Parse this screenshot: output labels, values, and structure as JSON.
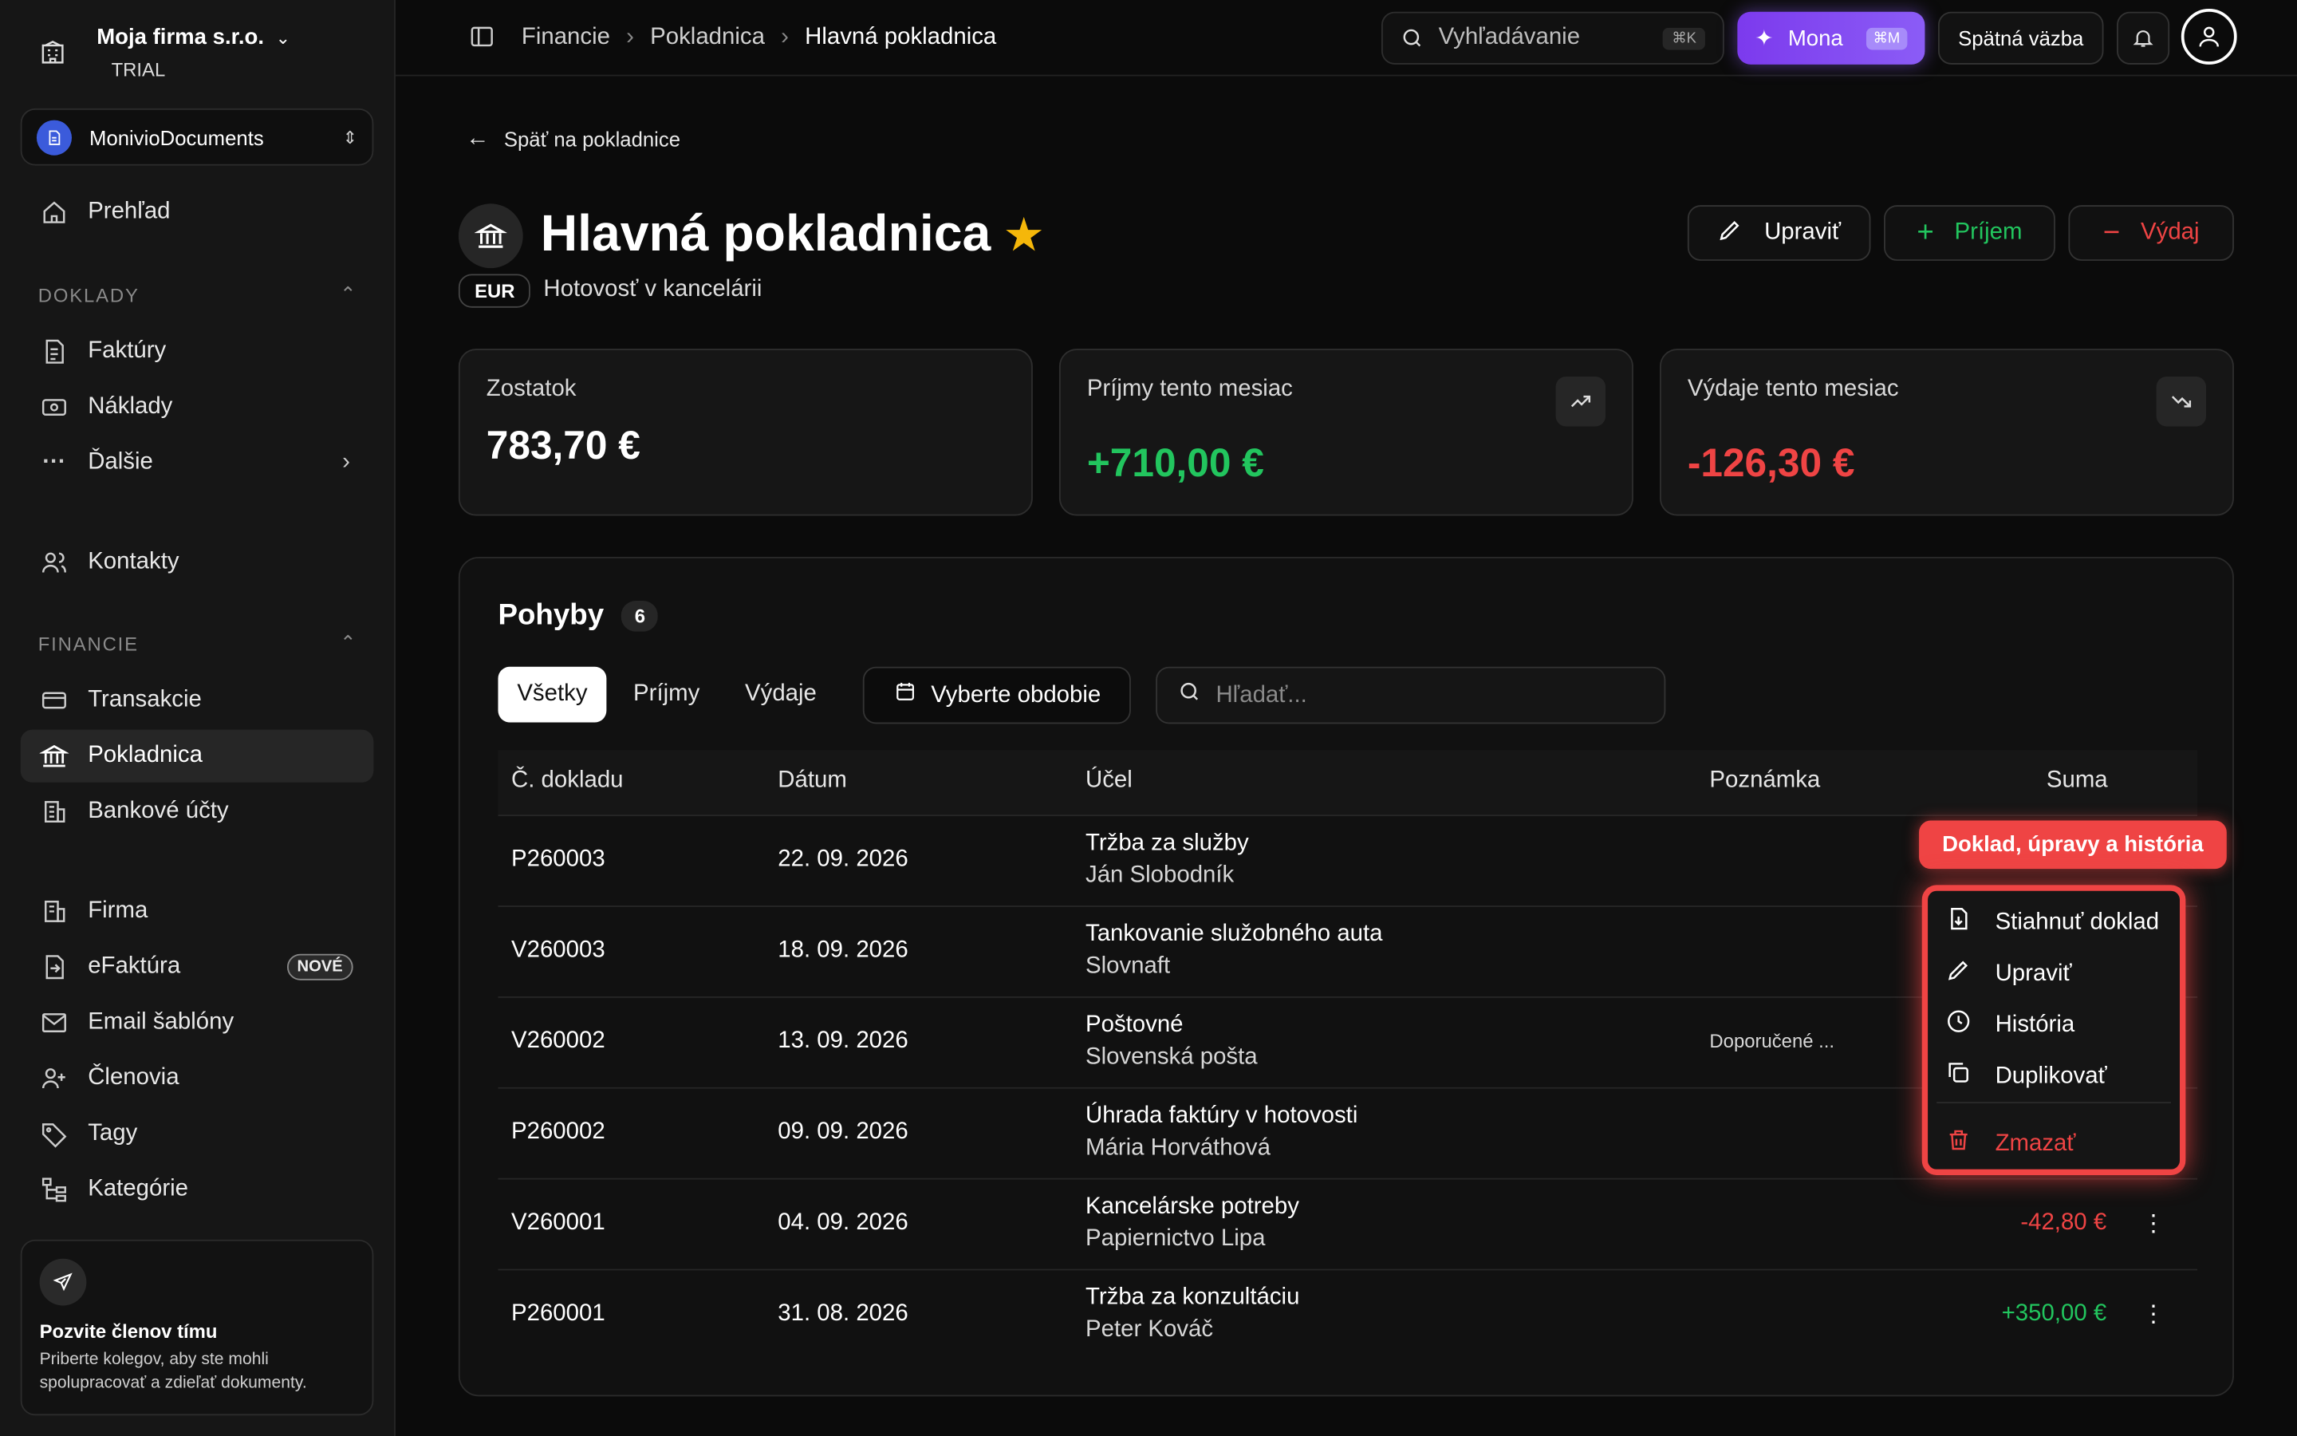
{
  "workspace": {
    "name": "Moja firma s.r.o.",
    "plan": "TRIAL"
  },
  "app_switcher": {
    "name": "MonivioDocuments"
  },
  "sidebar": {
    "overview": "Prehľad",
    "sections": {
      "documents": "DOKLADY",
      "finance": "FINANCIE"
    },
    "documents_items": [
      "Faktúry",
      "Náklady",
      "Ďalšie"
    ],
    "contacts": "Kontakty",
    "finance_items": [
      "Transakcie",
      "Pokladnica",
      "Bankové účty"
    ],
    "other_items": [
      "Firma",
      "eFaktúra",
      "Email šablóny",
      "Členovia",
      "Tagy",
      "Kategórie"
    ],
    "new_badge": "NOVÉ",
    "invite": {
      "title": "Pozvite členov tímu",
      "text": "Priberte kolegov, aby ste mohli spolupracovať a zdieľať dokumenty."
    }
  },
  "topbar": {
    "breadcrumbs": [
      "Financie",
      "Pokladnica",
      "Hlavná pokladnica"
    ],
    "search_placeholder": "Vyhľadávanie",
    "search_kbd": "⌘K",
    "mona_label": "Mona",
    "mona_kbd": "⌘M",
    "feedback_label": "Spätná väzba"
  },
  "page": {
    "back_label": "Späť na pokladnice",
    "title": "Hlavná pokladnica",
    "currency": "EUR",
    "subtitle": "Hotovosť v kancelárii",
    "edit_label": "Upraviť",
    "income_label": "Príjem",
    "expense_label": "Výdaj"
  },
  "stats": {
    "balance_label": "Zostatok",
    "balance_value": "783,70 €",
    "income_label": "Príjmy tento mesiac",
    "income_value": "+710,00 €",
    "expense_label": "Výdaje tento mesiac",
    "expense_value": "-126,30 €"
  },
  "movements": {
    "title": "Pohyby",
    "count": "6",
    "tabs": [
      "Všetky",
      "Príjmy",
      "Výdaje"
    ],
    "period_label": "Vyberte obdobie",
    "search_placeholder": "Hľadať...",
    "columns": [
      "Č. dokladu",
      "Dátum",
      "Účel",
      "Poznámka",
      "Suma"
    ],
    "rows": [
      {
        "doc": "P260003",
        "date": "22. 09. 2026",
        "purpose": "Tržba za služby",
        "party": "Ján Slobodník",
        "note": "",
        "amount": ""
      },
      {
        "doc": "V260003",
        "date": "18. 09. 2026",
        "purpose": "Tankovanie služobného auta",
        "party": "Slovnaft",
        "note": "",
        "amount": ""
      },
      {
        "doc": "V260002",
        "date": "13. 09. 2026",
        "purpose": "Poštovné",
        "party": "Slovenská pošta",
        "note": "Doporučené ...",
        "amount": ""
      },
      {
        "doc": "P260002",
        "date": "09. 09. 2026",
        "purpose": "Úhrada faktúry v hotovosti",
        "party": "Mária Horváthová",
        "note": "",
        "amount": ""
      },
      {
        "doc": "V260001",
        "date": "04. 09. 2026",
        "purpose": "Kancelárske potreby",
        "party": "Papiernictvo Lipa",
        "note": "",
        "amount": "-42,80 €"
      },
      {
        "doc": "P260001",
        "date": "31. 08. 2026",
        "purpose": "Tržba za konzultáciu",
        "party": "Peter Kováč",
        "note": "",
        "amount": "+350,00 €"
      }
    ]
  },
  "context_menu": {
    "tooltip": "Doklad, úpravy a história",
    "items": [
      "Stiahnuť doklad",
      "Upraviť",
      "História",
      "Duplikovať"
    ],
    "delete": "Zmazať"
  },
  "colors": {
    "accent_purple": "#8b5cf6",
    "positive": "#22c55e",
    "negative": "#ef4444",
    "star": "#f5b70a"
  }
}
